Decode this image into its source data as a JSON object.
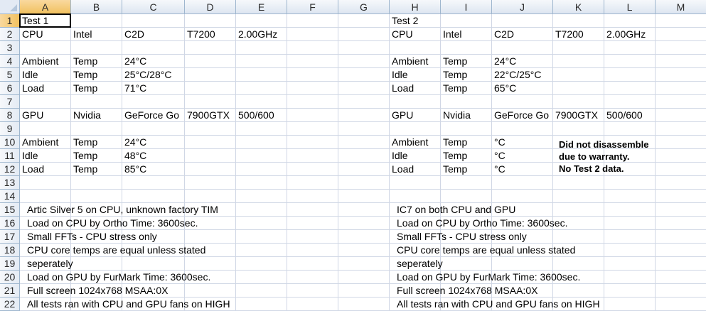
{
  "columns": [
    "A",
    "B",
    "C",
    "D",
    "E",
    "F",
    "G",
    "H",
    "I",
    "J",
    "K",
    "L",
    "M"
  ],
  "rows": [
    "1",
    "2",
    "3",
    "4",
    "5",
    "6",
    "7",
    "8",
    "9",
    "10",
    "11",
    "12",
    "13",
    "14",
    "15",
    "16",
    "17",
    "18",
    "19",
    "20",
    "21",
    "22"
  ],
  "cells": [
    {
      "r": 1,
      "c": "A",
      "v": "Test 1"
    },
    {
      "r": 1,
      "c": "H",
      "v": "Test 2"
    },
    {
      "r": 2,
      "c": "A",
      "v": "CPU"
    },
    {
      "r": 2,
      "c": "B",
      "v": "Intel"
    },
    {
      "r": 2,
      "c": "C",
      "v": "C2D"
    },
    {
      "r": 2,
      "c": "D",
      "v": "T7200"
    },
    {
      "r": 2,
      "c": "E",
      "v": "2.00GHz"
    },
    {
      "r": 2,
      "c": "H",
      "v": "CPU"
    },
    {
      "r": 2,
      "c": "I",
      "v": "Intel"
    },
    {
      "r": 2,
      "c": "J",
      "v": "C2D"
    },
    {
      "r": 2,
      "c": "K",
      "v": "T7200"
    },
    {
      "r": 2,
      "c": "L",
      "v": "2.00GHz"
    },
    {
      "r": 4,
      "c": "A",
      "v": "Ambient"
    },
    {
      "r": 4,
      "c": "B",
      "v": "Temp"
    },
    {
      "r": 4,
      "c": "C",
      "v": "24°C"
    },
    {
      "r": 4,
      "c": "H",
      "v": "Ambient"
    },
    {
      "r": 4,
      "c": "I",
      "v": "Temp"
    },
    {
      "r": 4,
      "c": "J",
      "v": "24°C"
    },
    {
      "r": 5,
      "c": "A",
      "v": "Idle"
    },
    {
      "r": 5,
      "c": "B",
      "v": "Temp"
    },
    {
      "r": 5,
      "c": "C",
      "v": "25°C/28°C"
    },
    {
      "r": 5,
      "c": "H",
      "v": "Idle"
    },
    {
      "r": 5,
      "c": "I",
      "v": "Temp"
    },
    {
      "r": 5,
      "c": "J",
      "v": "22°C/25°C"
    },
    {
      "r": 6,
      "c": "A",
      "v": "Load"
    },
    {
      "r": 6,
      "c": "B",
      "v": "Temp"
    },
    {
      "r": 6,
      "c": "C",
      "v": "71°C"
    },
    {
      "r": 6,
      "c": "H",
      "v": "Load"
    },
    {
      "r": 6,
      "c": "I",
      "v": "Temp"
    },
    {
      "r": 6,
      "c": "J",
      "v": "65°C"
    },
    {
      "r": 8,
      "c": "A",
      "v": "GPU"
    },
    {
      "r": 8,
      "c": "B",
      "v": "Nvidia"
    },
    {
      "r": 8,
      "c": "C",
      "v": "GeForce Go"
    },
    {
      "r": 8,
      "c": "D",
      "v": "7900GTX"
    },
    {
      "r": 8,
      "c": "E",
      "v": "500/600"
    },
    {
      "r": 8,
      "c": "H",
      "v": "GPU"
    },
    {
      "r": 8,
      "c": "I",
      "v": "Nvidia"
    },
    {
      "r": 8,
      "c": "J",
      "v": "GeForce Go"
    },
    {
      "r": 8,
      "c": "K",
      "v": "7900GTX"
    },
    {
      "r": 8,
      "c": "L",
      "v": "500/600"
    },
    {
      "r": 10,
      "c": "A",
      "v": "Ambient"
    },
    {
      "r": 10,
      "c": "B",
      "v": "Temp"
    },
    {
      "r": 10,
      "c": "C",
      "v": "24°C"
    },
    {
      "r": 10,
      "c": "H",
      "v": "Ambient"
    },
    {
      "r": 10,
      "c": "I",
      "v": "Temp"
    },
    {
      "r": 10,
      "c": "J",
      "v": "°C"
    },
    {
      "r": 11,
      "c": "A",
      "v": "Idle"
    },
    {
      "r": 11,
      "c": "B",
      "v": "Temp"
    },
    {
      "r": 11,
      "c": "C",
      "v": "48°C"
    },
    {
      "r": 11,
      "c": "H",
      "v": "Idle"
    },
    {
      "r": 11,
      "c": "I",
      "v": "Temp"
    },
    {
      "r": 11,
      "c": "J",
      "v": "°C"
    },
    {
      "r": 12,
      "c": "A",
      "v": "Load"
    },
    {
      "r": 12,
      "c": "B",
      "v": "Temp"
    },
    {
      "r": 12,
      "c": "C",
      "v": "85°C"
    },
    {
      "r": 12,
      "c": "H",
      "v": "Load"
    },
    {
      "r": 12,
      "c": "I",
      "v": "Temp"
    },
    {
      "r": 12,
      "c": "J",
      "v": "°C"
    },
    {
      "r": 15,
      "c": "A",
      "v": "Artic Silver 5 on CPU, unknown factory TIM",
      "indent": true
    },
    {
      "r": 16,
      "c": "A",
      "v": "Load on CPU by Ortho Time: 3600sec.",
      "indent": true
    },
    {
      "r": 17,
      "c": "A",
      "v": "Small FFTs - CPU stress only",
      "indent": true
    },
    {
      "r": 18,
      "c": "A",
      "v": "CPU core temps are equal unless stated",
      "indent": true
    },
    {
      "r": 19,
      "c": "A",
      "v": "seperately",
      "indent": true
    },
    {
      "r": 20,
      "c": "A",
      "v": "Load on GPU by FurMark Time: 3600sec.",
      "indent": true
    },
    {
      "r": 21,
      "c": "A",
      "v": "Full screen 1024x768 MSAA:0X",
      "indent": true
    },
    {
      "r": 22,
      "c": "A",
      "v": "All tests ran with CPU and GPU fans on HIGH",
      "indent": true
    },
    {
      "r": 15,
      "c": "H",
      "v": "IC7 on both CPU and GPU",
      "indent": true
    },
    {
      "r": 16,
      "c": "H",
      "v": "Load on CPU by Ortho Time: 3600sec.",
      "indent": true
    },
    {
      "r": 17,
      "c": "H",
      "v": "Small FFTs - CPU stress only",
      "indent": true
    },
    {
      "r": 18,
      "c": "H",
      "v": "CPU core temps are equal unless stated",
      "indent": true
    },
    {
      "r": 19,
      "c": "H",
      "v": "seperately",
      "indent": true
    },
    {
      "r": 20,
      "c": "H",
      "v": "Load on GPU by FurMark Time: 3600sec.",
      "indent": true
    },
    {
      "r": 21,
      "c": "H",
      "v": "Full screen 1024x768 MSAA:0X",
      "indent": true
    },
    {
      "r": 22,
      "c": "H",
      "v": "All tests ran with CPU and GPU fans on HIGH",
      "indent": true
    }
  ],
  "note": {
    "lines": [
      "Did not disassemble",
      "due to warranty.",
      "No Test 2 data."
    ]
  }
}
